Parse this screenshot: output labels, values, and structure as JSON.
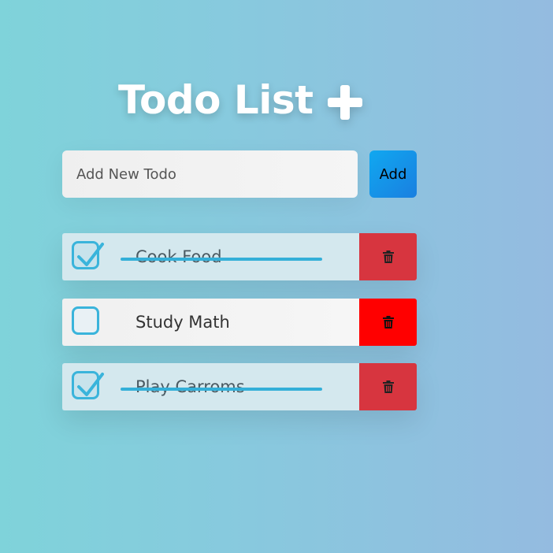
{
  "header": {
    "title": "Todo List",
    "add_icon": "plus-icon"
  },
  "new_todo": {
    "placeholder": "Add New Todo",
    "value": "",
    "add_label": "Add"
  },
  "todos": [
    {
      "text": "Cook Food",
      "completed": true
    },
    {
      "text": "Study Math",
      "completed": false
    },
    {
      "text": "Play Carroms",
      "completed": true
    }
  ],
  "icons": {
    "checkbox": "checkmark-icon",
    "delete": "trash-icon"
  },
  "colors": {
    "background_start": "#7fd3da",
    "background_end": "#94bbe0",
    "accent": "#3ab4db",
    "add_button": "#1a8fe8",
    "delete_completed": "#d7353f",
    "delete_active": "#ff0000"
  }
}
